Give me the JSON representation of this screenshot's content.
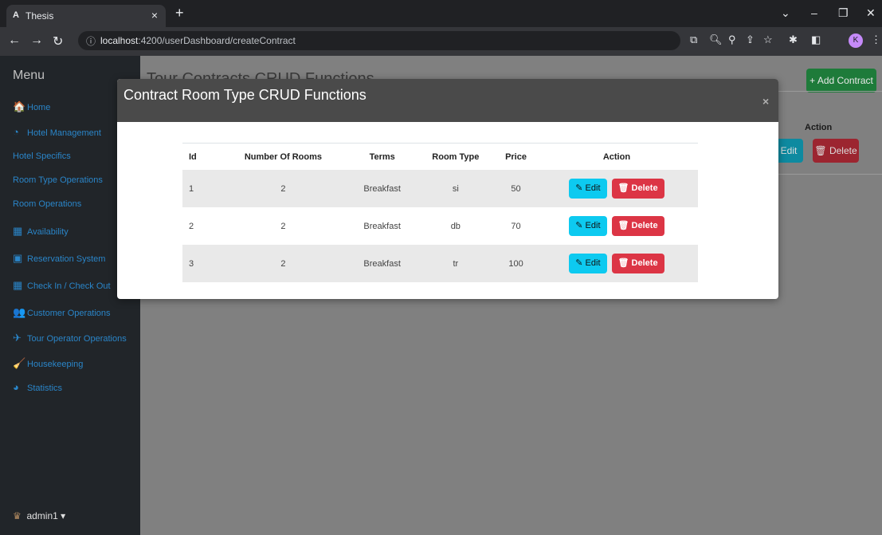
{
  "browser": {
    "tab_title": "Thesis",
    "tab_favicon": "A",
    "url_host": "localhost",
    "url_path": ":4200/userDashboard/createContract",
    "profile_initial": "K"
  },
  "sidebar": {
    "title": "Menu",
    "items": [
      {
        "label": "Home",
        "icon": "home-icon",
        "glyph": "🏠"
      },
      {
        "label": "Hotel Management",
        "icon": "dashboard-icon",
        "glyph": "◔"
      },
      {
        "label": "Hotel Specifics"
      },
      {
        "label": "Room Type Operations"
      },
      {
        "label": "Room Operations"
      },
      {
        "label": "Availability",
        "icon": "table-icon",
        "glyph": "▦"
      },
      {
        "label": "Reservation System",
        "icon": "calendar-icon",
        "glyph": "▣"
      },
      {
        "label": "Check In / Check Out",
        "icon": "calendar-check-icon",
        "glyph": "▦"
      },
      {
        "label": "Customer Operations",
        "icon": "people-icon",
        "glyph": "👥"
      },
      {
        "label": "Tour Operator Operations",
        "icon": "plane-icon",
        "glyph": "✈"
      },
      {
        "label": "Housekeeping",
        "icon": "broom-icon",
        "glyph": "🧹"
      },
      {
        "label": "Statistics",
        "icon": "pie-chart-icon",
        "glyph": "◕"
      }
    ],
    "user": "admin1"
  },
  "page": {
    "title": "Tour Contracts CRUD Functions",
    "add_button": "+ Add Contract",
    "action_header": "Action",
    "edit_label": "Edit",
    "delete_label": "Delete"
  },
  "modal": {
    "title": "Contract Room Type CRUD Functions",
    "close": "×",
    "columns": [
      "Id",
      "Number Of Rooms",
      "Terms",
      "Room Type",
      "Price",
      "Action"
    ],
    "rows": [
      {
        "id": "1",
        "rooms": "2",
        "terms": "Breakfast",
        "room_type": "si",
        "price": "50"
      },
      {
        "id": "2",
        "rooms": "2",
        "terms": "Breakfast",
        "room_type": "db",
        "price": "70"
      },
      {
        "id": "3",
        "rooms": "2",
        "terms": "Breakfast",
        "room_type": "tr",
        "price": "100"
      }
    ],
    "edit_label": "Edit",
    "delete_label": "Delete"
  },
  "colors": {
    "sidebar_bg": "#212529",
    "sidebar_link": "#2a85c8",
    "edit_btn": "#0dcaf0",
    "delete_btn": "#dc3545",
    "add_btn": "#1e7b3a",
    "modal_header": "#4a4a4a"
  }
}
